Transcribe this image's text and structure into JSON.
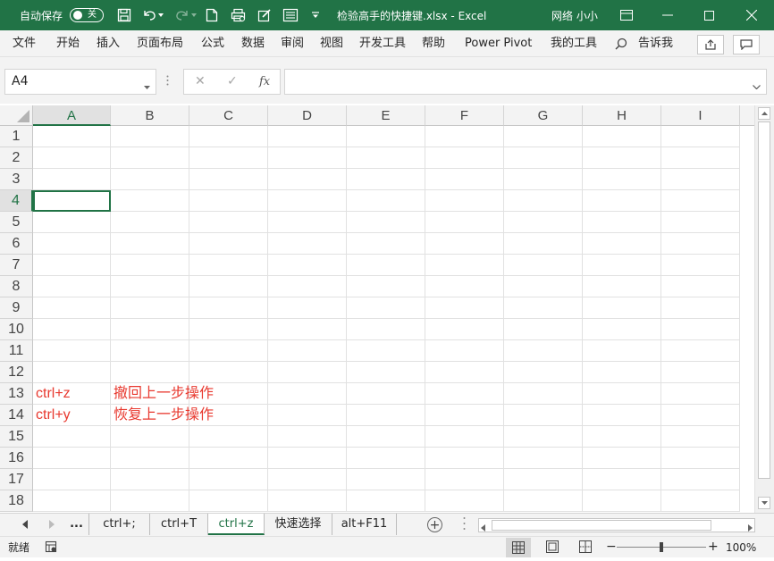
{
  "titlebar": {
    "autosave_label": "自动保存",
    "autosave_state": "关",
    "doc_title": "检验高手的快捷键.xlsx  -  Excel",
    "user_name": "网络 小小",
    "bg_color": "#217346"
  },
  "ribbon": {
    "tabs": [
      "文件",
      "开始",
      "插入",
      "页面布局",
      "公式",
      "数据",
      "审阅",
      "视图",
      "开发工具",
      "帮助",
      "Power Pivot",
      "我的工具"
    ],
    "tell_me": "告诉我"
  },
  "formula_bar": {
    "name_box": "A4",
    "formula_value": ""
  },
  "grid": {
    "columns": [
      "A",
      "B",
      "C",
      "D",
      "E",
      "F",
      "G",
      "H",
      "I"
    ],
    "rows": [
      "1",
      "2",
      "3",
      "4",
      "5",
      "6",
      "7",
      "8",
      "9",
      "10",
      "11",
      "12",
      "13",
      "14",
      "15",
      "16",
      "17",
      "18"
    ],
    "cells": {
      "A13": "ctrl+z",
      "B13": "撤回上一步操作",
      "A14": "ctrl+y",
      "B14": "恢复上一步操作"
    },
    "text_color": "#e8392f"
  },
  "sheets": {
    "ellipsis": "...",
    "tabs": [
      "ctrl+;",
      "ctrl+T",
      "ctrl+z",
      "快速选择",
      "alt+F11"
    ],
    "active": "ctrl+z",
    "add_symbol": "+"
  },
  "statusbar": {
    "status": "就绪",
    "zoom_label": "100%",
    "zoom_percent": 100
  }
}
